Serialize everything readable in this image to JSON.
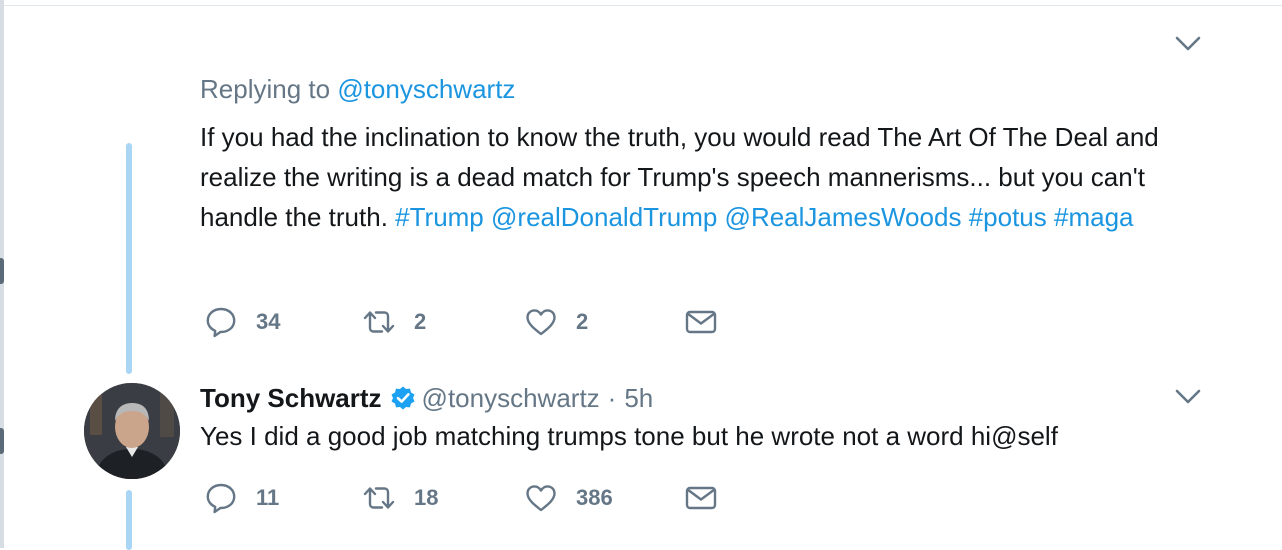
{
  "tweet1": {
    "replying_prefix": "Replying to",
    "replying_handle": "@tonyschwartz",
    "text_plain": "If you had the inclination to know the truth, you would read The Art Of The Deal and realize the writing is a dead match for Trump's speech mannerisms... but you can't handle the truth.",
    "hashtag_trump": "#Trump",
    "mention_realdonaldtrump": "@realDonaldTrump",
    "mention_realjameswoods": "@RealJamesWoods",
    "hashtag_potus": "#potus",
    "hashtag_maga": "#maga",
    "replies": "34",
    "retweets": "2",
    "likes": "2"
  },
  "tweet2": {
    "display_name": "Tony Schwartz",
    "handle": "@tonyschwartz",
    "separator": "·",
    "time": "5h",
    "text": "Yes I did a good job matching trumps tone but he wrote not a word hi@self",
    "replies": "11",
    "retweets": "18",
    "likes": "386"
  },
  "colors": {
    "link": "#1b95e0",
    "secondary_text": "#657786",
    "thread_line": "#a9d6f5",
    "verified_badge": "#1da1f2"
  },
  "icons": [
    "chevron-down-icon",
    "reply-icon",
    "retweet-icon",
    "like-icon",
    "direct-message-icon",
    "verified-badge-icon"
  ]
}
